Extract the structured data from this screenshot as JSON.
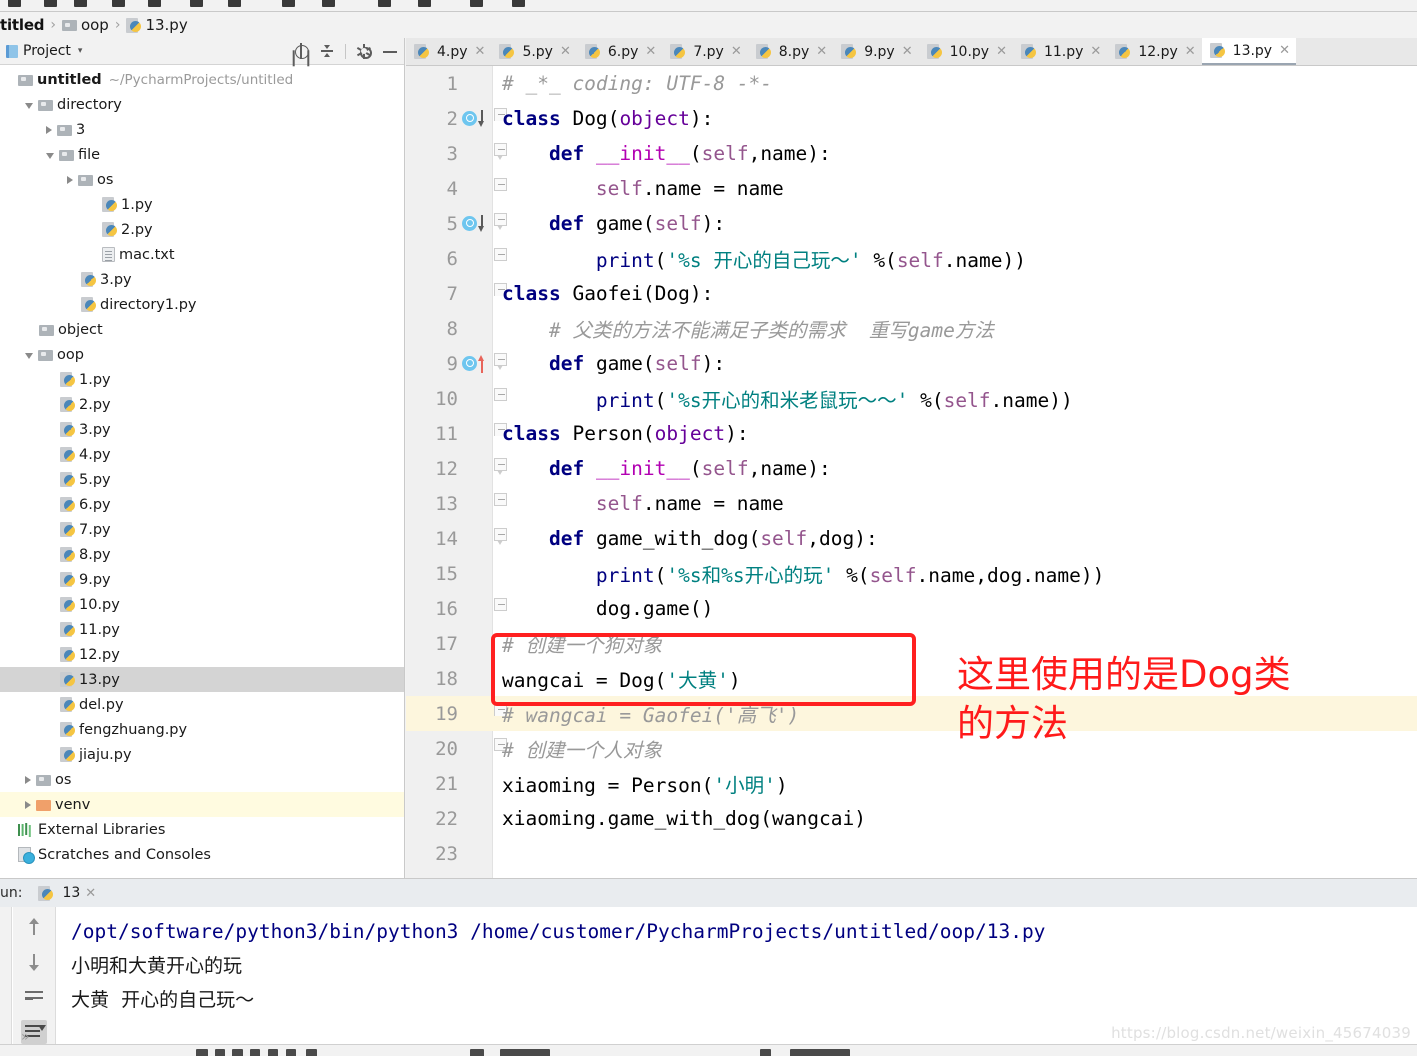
{
  "breadcrumb": {
    "project": "titled",
    "sep": "›",
    "folder": "oop",
    "file": "13.py"
  },
  "project_panel": {
    "title": "Project",
    "caret": "▾",
    "tools": [
      {
        "name": "locate-icon",
        "label": "Select Opened File"
      },
      {
        "name": "collapse-all-icon",
        "label": "Collapse All"
      },
      {
        "name": "gear-icon",
        "label": "Settings"
      },
      {
        "name": "minimize-icon",
        "label": "Hide"
      }
    ],
    "tree": [
      {
        "label": "untitled",
        "path": "~/PycharmProjects/untitled",
        "indent": 0,
        "twisty": "none",
        "icon": "folder",
        "bold": true
      },
      {
        "label": "directory",
        "indent": 1,
        "twisty": "open",
        "icon": "folder"
      },
      {
        "label": "3",
        "indent": 2,
        "twisty": "closed",
        "icon": "folder"
      },
      {
        "label": "file",
        "indent": 2,
        "twisty": "open",
        "icon": "folder"
      },
      {
        "label": "os",
        "indent": 3,
        "twisty": "closed",
        "icon": "folder"
      },
      {
        "label": "1.py",
        "indent": 4,
        "twisty": "none",
        "icon": "py"
      },
      {
        "label": "2.py",
        "indent": 4,
        "twisty": "none",
        "icon": "py"
      },
      {
        "label": "mac.txt",
        "indent": 4,
        "twisty": "none",
        "icon": "txt"
      },
      {
        "label": "3.py",
        "indent": 3,
        "twisty": "none",
        "icon": "py"
      },
      {
        "label": "directory1.py",
        "indent": 3,
        "twisty": "none",
        "icon": "py"
      },
      {
        "label": "object",
        "indent": 1,
        "twisty": "none",
        "icon": "folder"
      },
      {
        "label": "oop",
        "indent": 1,
        "twisty": "open",
        "icon": "folder"
      },
      {
        "label": "1.py",
        "indent": 2,
        "twisty": "none",
        "icon": "py"
      },
      {
        "label": "2.py",
        "indent": 2,
        "twisty": "none",
        "icon": "py"
      },
      {
        "label": "3.py",
        "indent": 2,
        "twisty": "none",
        "icon": "py"
      },
      {
        "label": "4.py",
        "indent": 2,
        "twisty": "none",
        "icon": "py"
      },
      {
        "label": "5.py",
        "indent": 2,
        "twisty": "none",
        "icon": "py"
      },
      {
        "label": "6.py",
        "indent": 2,
        "twisty": "none",
        "icon": "py"
      },
      {
        "label": "7.py",
        "indent": 2,
        "twisty": "none",
        "icon": "py"
      },
      {
        "label": "8.py",
        "indent": 2,
        "twisty": "none",
        "icon": "py"
      },
      {
        "label": "9.py",
        "indent": 2,
        "twisty": "none",
        "icon": "py"
      },
      {
        "label": "10.py",
        "indent": 2,
        "twisty": "none",
        "icon": "py"
      },
      {
        "label": "11.py",
        "indent": 2,
        "twisty": "none",
        "icon": "py"
      },
      {
        "label": "12.py",
        "indent": 2,
        "twisty": "none",
        "icon": "py"
      },
      {
        "label": "13.py",
        "indent": 2,
        "twisty": "none",
        "icon": "py",
        "selected": true
      },
      {
        "label": "del.py",
        "indent": 2,
        "twisty": "none",
        "icon": "py"
      },
      {
        "label": "fengzhuang.py",
        "indent": 2,
        "twisty": "none",
        "icon": "py"
      },
      {
        "label": "jiaju.py",
        "indent": 2,
        "twisty": "none",
        "icon": "py"
      },
      {
        "label": "os",
        "indent": 1,
        "twisty": "closed",
        "icon": "folder"
      },
      {
        "label": "venv",
        "indent": 1,
        "twisty": "closed",
        "icon": "folder-orange",
        "highlight": true
      },
      {
        "label": "External Libraries",
        "indent": 0,
        "twisty": "none",
        "icon": "extlib"
      },
      {
        "label": "Scratches and Consoles",
        "indent": 0,
        "twisty": "none",
        "icon": "scratch"
      }
    ]
  },
  "tabs": [
    {
      "label": "4.py",
      "active": false
    },
    {
      "label": "5.py",
      "active": false
    },
    {
      "label": "6.py",
      "active": false
    },
    {
      "label": "7.py",
      "active": false
    },
    {
      "label": "8.py",
      "active": false
    },
    {
      "label": "9.py",
      "active": false
    },
    {
      "label": "10.py",
      "active": false
    },
    {
      "label": "11.py",
      "active": false
    },
    {
      "label": "12.py",
      "active": false
    },
    {
      "label": "13.py",
      "active": true
    }
  ],
  "tab_close_glyph": "✕",
  "editor": {
    "lines": [
      {
        "n": "1",
        "marker": "none",
        "fold": "none",
        "highlight": false,
        "tokens": [
          {
            "t": "# _*_ coding: UTF-8 -*-",
            "c": "t-cmt"
          }
        ]
      },
      {
        "n": "2",
        "marker": "down",
        "fold": "top",
        "highlight": false,
        "tokens": [
          {
            "t": "class ",
            "c": "t-kw"
          },
          {
            "t": "Dog",
            "c": "t-pln"
          },
          {
            "t": "(",
            "c": "t-pln"
          },
          {
            "t": "object",
            "c": "t-builtin"
          },
          {
            "t": "):",
            "c": "t-pln"
          }
        ]
      },
      {
        "n": "3",
        "marker": "none",
        "fold": "mid",
        "highlight": false,
        "tokens": [
          {
            "t": "    ",
            "c": "t-pln"
          },
          {
            "t": "def ",
            "c": "t-kw"
          },
          {
            "t": "__init__",
            "c": "t-magic"
          },
          {
            "t": "(",
            "c": "t-pln"
          },
          {
            "t": "self",
            "c": "t-self"
          },
          {
            "t": ",name):",
            "c": "t-pln"
          }
        ]
      },
      {
        "n": "4",
        "marker": "none",
        "fold": "end",
        "highlight": false,
        "tokens": [
          {
            "t": "        ",
            "c": "t-pln"
          },
          {
            "t": "self",
            "c": "t-self"
          },
          {
            "t": ".name = name",
            "c": "t-pln"
          }
        ]
      },
      {
        "n": "5",
        "marker": "down",
        "fold": "mid",
        "highlight": false,
        "tokens": [
          {
            "t": "    ",
            "c": "t-pln"
          },
          {
            "t": "def ",
            "c": "t-kw"
          },
          {
            "t": "game",
            "c": "t-pln"
          },
          {
            "t": "(",
            "c": "t-pln"
          },
          {
            "t": "self",
            "c": "t-self"
          },
          {
            "t": "):",
            "c": "t-pln"
          }
        ]
      },
      {
        "n": "6",
        "marker": "none",
        "fold": "end",
        "highlight": false,
        "tokens": [
          {
            "t": "        ",
            "c": "t-pln"
          },
          {
            "t": "print",
            "c": "t-pfn"
          },
          {
            "t": "(",
            "c": "t-pln"
          },
          {
            "t": "'%s 开心的自己玩～'",
            "c": "t-str"
          },
          {
            "t": " %(",
            "c": "t-pln"
          },
          {
            "t": "self",
            "c": "t-self"
          },
          {
            "t": ".name))",
            "c": "t-pln"
          }
        ]
      },
      {
        "n": "7",
        "marker": "none",
        "fold": "top",
        "highlight": false,
        "tokens": [
          {
            "t": "class ",
            "c": "t-kw"
          },
          {
            "t": "Gaofei",
            "c": "t-pln"
          },
          {
            "t": "(Dog):",
            "c": "t-pln"
          }
        ]
      },
      {
        "n": "8",
        "marker": "none",
        "fold": "none",
        "highlight": false,
        "tokens": [
          {
            "t": "    ",
            "c": "t-pln"
          },
          {
            "t": "# 父类的方法不能满足子类的需求  重写game方法",
            "c": "t-cmt"
          }
        ]
      },
      {
        "n": "9",
        "marker": "up",
        "fold": "mid",
        "highlight": false,
        "tokens": [
          {
            "t": "    ",
            "c": "t-pln"
          },
          {
            "t": "def ",
            "c": "t-kw"
          },
          {
            "t": "game",
            "c": "t-pln"
          },
          {
            "t": "(",
            "c": "t-pln"
          },
          {
            "t": "self",
            "c": "t-self"
          },
          {
            "t": "):",
            "c": "t-pln"
          }
        ]
      },
      {
        "n": "10",
        "marker": "none",
        "fold": "end",
        "highlight": false,
        "tokens": [
          {
            "t": "        ",
            "c": "t-pln"
          },
          {
            "t": "print",
            "c": "t-pfn"
          },
          {
            "t": "(",
            "c": "t-pln"
          },
          {
            "t": "'%s开心的和米老鼠玩～～'",
            "c": "t-str"
          },
          {
            "t": " %(",
            "c": "t-pln"
          },
          {
            "t": "self",
            "c": "t-self"
          },
          {
            "t": ".name))",
            "c": "t-pln"
          }
        ]
      },
      {
        "n": "11",
        "marker": "none",
        "fold": "top",
        "highlight": false,
        "tokens": [
          {
            "t": "class ",
            "c": "t-kw"
          },
          {
            "t": "Person",
            "c": "t-pln"
          },
          {
            "t": "(",
            "c": "t-pln"
          },
          {
            "t": "object",
            "c": "t-builtin"
          },
          {
            "t": "):",
            "c": "t-pln"
          }
        ]
      },
      {
        "n": "12",
        "marker": "none",
        "fold": "mid",
        "highlight": false,
        "tokens": [
          {
            "t": "    ",
            "c": "t-pln"
          },
          {
            "t": "def ",
            "c": "t-kw"
          },
          {
            "t": "__init__",
            "c": "t-magic"
          },
          {
            "t": "(",
            "c": "t-pln"
          },
          {
            "t": "self",
            "c": "t-self"
          },
          {
            "t": ",name):",
            "c": "t-pln"
          }
        ]
      },
      {
        "n": "13",
        "marker": "none",
        "fold": "end",
        "highlight": false,
        "tokens": [
          {
            "t": "        ",
            "c": "t-pln"
          },
          {
            "t": "self",
            "c": "t-self"
          },
          {
            "t": ".name = name",
            "c": "t-pln"
          }
        ]
      },
      {
        "n": "14",
        "marker": "none",
        "fold": "mid",
        "highlight": false,
        "tokens": [
          {
            "t": "    ",
            "c": "t-pln"
          },
          {
            "t": "def ",
            "c": "t-kw"
          },
          {
            "t": "game_with_dog",
            "c": "t-pln"
          },
          {
            "t": "(",
            "c": "t-pln"
          },
          {
            "t": "self",
            "c": "t-self"
          },
          {
            "t": ",dog):",
            "c": "t-pln"
          }
        ]
      },
      {
        "n": "15",
        "marker": "none",
        "fold": "none",
        "highlight": false,
        "tokens": [
          {
            "t": "        ",
            "c": "t-pln"
          },
          {
            "t": "print",
            "c": "t-pfn"
          },
          {
            "t": "(",
            "c": "t-pln"
          },
          {
            "t": "'%s和%s开心的玩'",
            "c": "t-str"
          },
          {
            "t": " %(",
            "c": "t-pln"
          },
          {
            "t": "self",
            "c": "t-self"
          },
          {
            "t": ".name,dog.name))",
            "c": "t-pln"
          }
        ]
      },
      {
        "n": "16",
        "marker": "none",
        "fold": "end",
        "highlight": false,
        "tokens": [
          {
            "t": "        ",
            "c": "t-pln"
          },
          {
            "t": "dog.game()",
            "c": "t-pln"
          }
        ]
      },
      {
        "n": "17",
        "marker": "none",
        "fold": "none",
        "highlight": false,
        "tokens": [
          {
            "t": "# 创建一个狗对象",
            "c": "t-cmt"
          }
        ]
      },
      {
        "n": "18",
        "marker": "none",
        "fold": "none",
        "highlight": false,
        "tokens": [
          {
            "t": "wangcai = Dog(",
            "c": "t-pln"
          },
          {
            "t": "'大黄'",
            "c": "t-str"
          },
          {
            "t": ")",
            "c": "t-pln"
          }
        ]
      },
      {
        "n": "19",
        "marker": "none",
        "fold": "top",
        "highlight": true,
        "tokens": [
          {
            "t": "# wangcai = Gaofei('高飞')",
            "c": "t-cmt"
          }
        ]
      },
      {
        "n": "20",
        "marker": "none",
        "fold": "end",
        "highlight": false,
        "tokens": [
          {
            "t": "# 创建一个人对象",
            "c": "t-cmt"
          }
        ]
      },
      {
        "n": "21",
        "marker": "none",
        "fold": "none",
        "highlight": false,
        "tokens": [
          {
            "t": "xiaoming = Person(",
            "c": "t-pln"
          },
          {
            "t": "'小明'",
            "c": "t-str"
          },
          {
            "t": ")",
            "c": "t-pln"
          }
        ]
      },
      {
        "n": "22",
        "marker": "none",
        "fold": "none",
        "highlight": false,
        "tokens": [
          {
            "t": "xiaoming.game_with_dog(wangcai)",
            "c": "t-pln"
          }
        ]
      },
      {
        "n": "23",
        "marker": "none",
        "fold": "none",
        "highlight": false,
        "tokens": []
      }
    ]
  },
  "annotation": {
    "line1": "这里使用的是Dog类",
    "line2": "的方法",
    "color": "#ff1a1a"
  },
  "run_panel": {
    "label": "un:",
    "tab_label": "13",
    "close_glyph": "✕",
    "toolbar": [
      {
        "name": "scroll-up-icon",
        "active": false
      },
      {
        "name": "scroll-down-icon",
        "active": false
      },
      {
        "name": "soft-wrap-icon",
        "active": false
      },
      {
        "name": "scroll-to-end-icon",
        "active": true
      }
    ],
    "more_glyph": "»",
    "console": [
      {
        "text": "/opt/software/python3/bin/python3 /home/customer/PycharmProjects/untitled/oop/13.py",
        "style": "c-cmd"
      },
      {
        "text": "小明和大黄开心的玩",
        "style": "c-out"
      },
      {
        "text": "大黄  开心的自己玩～",
        "style": "c-out"
      }
    ]
  },
  "watermark": "https://blog.csdn.net/weixin_45674039"
}
